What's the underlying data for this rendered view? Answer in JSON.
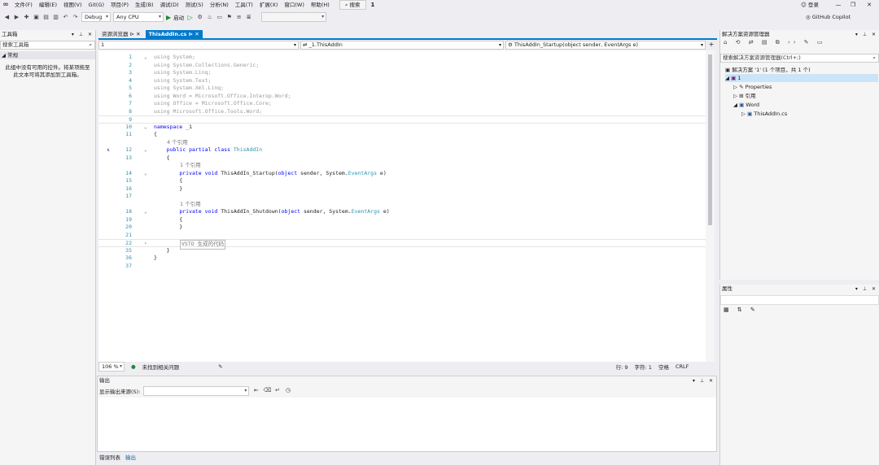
{
  "menu": {
    "items": [
      "文件(F)",
      "编辑(E)",
      "视图(V)",
      "Git(G)",
      "项目(P)",
      "生成(B)",
      "调试(D)",
      "测试(S)",
      "分析(N)",
      "工具(T)",
      "扩展(X)",
      "窗口(W)",
      "帮助(H)"
    ],
    "search": "搜索",
    "solution_name": "1",
    "login": "登录",
    "copilot": "GitHub Copilot"
  },
  "toolbar": {
    "config": "Debug",
    "platform": "Any CPU",
    "start": "启动"
  },
  "toolbox": {
    "title": "工具箱",
    "search_placeholder": "搜索工具箱",
    "group": "常规",
    "empty_message": "此组中没有可用的控件。将某项拖至此文本可将其添加到工具箱。"
  },
  "editor_tabs": [
    {
      "label": "资源浏览器"
    },
    {
      "label": "ThisAddIn.cs"
    }
  ],
  "navbar": {
    "project": "1",
    "class": "_1.ThisAddIn",
    "member": "ThisAddIn_Startup(object sender, EventArgs e)"
  },
  "code": {
    "lines": [
      {
        "n": "1",
        "t": "using System;",
        "c": "gray"
      },
      {
        "n": "2",
        "t": "using System.Collections.Generic;",
        "c": "gray"
      },
      {
        "n": "3",
        "t": "using System.Linq;",
        "c": "gray"
      },
      {
        "n": "4",
        "t": "using System.Text;",
        "c": "gray"
      },
      {
        "n": "5",
        "t": "using System.Xml.Linq;",
        "c": "gray"
      },
      {
        "n": "6",
        "t": "using Word = Microsoft.Office.Interop.Word;",
        "c": "gray"
      },
      {
        "n": "7",
        "t": "using Office = Microsoft.Office.Core;",
        "c": "gray"
      },
      {
        "n": "8",
        "t": "using Microsoft.Office.Tools.Word;",
        "c": "gray"
      },
      {
        "n": "9",
        "t": "",
        "c": ""
      },
      {
        "n": "10",
        "t": "namespace _1",
        "c": ""
      },
      {
        "n": "11",
        "t": "{",
        "c": ""
      },
      {
        "n": "",
        "t": "    4 个引用",
        "c": "ref"
      },
      {
        "n": "12",
        "t": "    public partial class ThisAddIn",
        "c": ""
      },
      {
        "n": "13",
        "t": "    {",
        "c": ""
      },
      {
        "n": "",
        "t": "        1 个引用",
        "c": "ref"
      },
      {
        "n": "14",
        "t": "        private void ThisAddIn_Startup(object sender, System.EventArgs e)",
        "c": ""
      },
      {
        "n": "15",
        "t": "        {",
        "c": ""
      },
      {
        "n": "16",
        "t": "        }",
        "c": ""
      },
      {
        "n": "17",
        "t": "",
        "c": ""
      },
      {
        "n": "",
        "t": "        1 个引用",
        "c": "ref"
      },
      {
        "n": "18",
        "t": "        private void ThisAddIn_Shutdown(object sender, System.EventArgs e)",
        "c": ""
      },
      {
        "n": "19",
        "t": "        {",
        "c": ""
      },
      {
        "n": "20",
        "t": "        }",
        "c": ""
      },
      {
        "n": "21",
        "t": "",
        "c": ""
      },
      {
        "n": "22",
        "t": "        VSTO 生成的代码",
        "c": "region"
      },
      {
        "n": "35",
        "t": "    }",
        "c": ""
      },
      {
        "n": "36",
        "t": "}",
        "c": ""
      },
      {
        "n": "37",
        "t": "",
        "c": ""
      }
    ]
  },
  "status": {
    "zoom": "106 %",
    "issues": "未找到相关问题",
    "line": "行: 9",
    "char": "字符: 1",
    "mode": "空格",
    "eol": "CRLF"
  },
  "output": {
    "title": "输出",
    "source_label": "显示输出来源(S):"
  },
  "bottom_tabs": [
    "错误列表",
    "输出"
  ],
  "solution_explorer": {
    "title": "解决方案资源管理器",
    "search_placeholder": "搜索解决方案资源管理器(Ctrl+;)",
    "solution_label": "解决方案 '1' (1 个项目，共 1 个)",
    "project": "1",
    "items": [
      "Properties",
      "引用",
      "Word",
      "ThisAddIn.cs"
    ]
  },
  "properties": {
    "title": "属性"
  },
  "colors": {
    "accent": "#007acc",
    "keyword": "#0000ff",
    "type": "#2b91af"
  }
}
